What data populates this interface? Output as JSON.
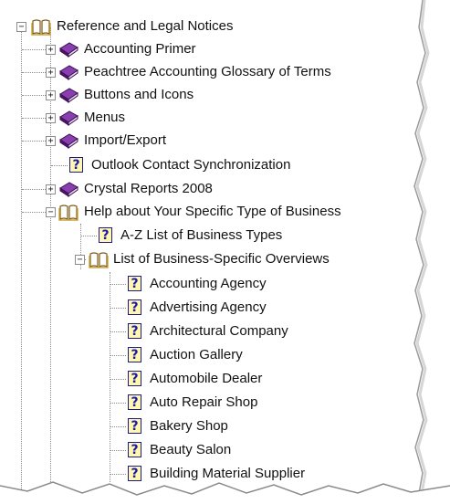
{
  "tree": {
    "root": {
      "label": "Reference and Legal Notices",
      "expander": "−"
    },
    "children": [
      {
        "label": "Accounting Primer",
        "expander": "+",
        "icon": "closed-book-icon"
      },
      {
        "label": "Peachtree Accounting Glossary of Terms",
        "expander": "+",
        "icon": "closed-book-icon"
      },
      {
        "label": "Buttons and Icons",
        "expander": "+",
        "icon": "closed-book-icon"
      },
      {
        "label": "Menus",
        "expander": "+",
        "icon": "closed-book-icon"
      },
      {
        "label": "Import/Export",
        "expander": "+",
        "icon": "closed-book-icon"
      },
      {
        "label": "Outlook Contact Synchronization",
        "icon": "help-page-icon"
      },
      {
        "label": "Crystal Reports 2008",
        "expander": "+",
        "icon": "closed-book-icon"
      }
    ],
    "business": {
      "label": "Help about Your Specific Type of Business",
      "expander": "−",
      "az": {
        "label": "A-Z List of Business Types"
      },
      "overviews": {
        "label": "List of Business-Specific Overviews",
        "expander": "−",
        "items": [
          "Accounting Agency",
          "Advertising Agency",
          "Architectural Company",
          "Auction Gallery",
          "Automobile Dealer",
          "Auto Repair Shop",
          "Bakery Shop",
          "Beauty Salon",
          "Building Material Supplier"
        ]
      }
    }
  },
  "glyphs": {
    "help": "?"
  },
  "colors": {
    "book_purple": "#6b2a8c",
    "book_open_gold": "#c9a23a",
    "help_blue": "#1a1aa6",
    "help_bg": "#fff7b0"
  }
}
